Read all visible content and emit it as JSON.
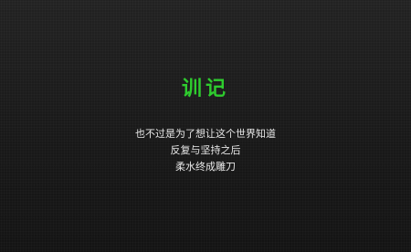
{
  "title": "训记",
  "accent_color": "#2ecc2e",
  "poem": {
    "lines": [
      "也不过是为了想让这个世界知道",
      "反复与坚持之后",
      "柔水终成雕刀"
    ]
  }
}
